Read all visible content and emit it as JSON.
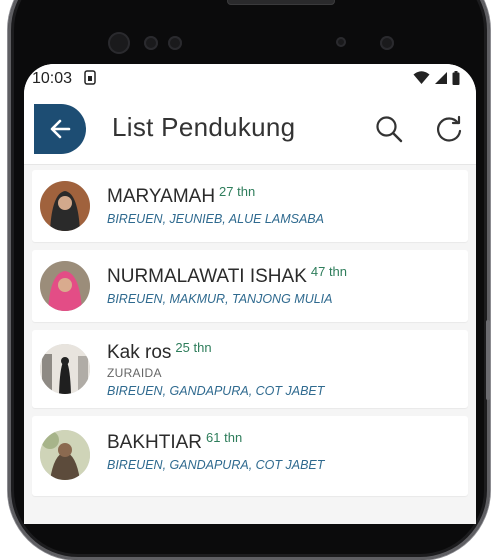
{
  "status_bar": {
    "time": "10:03",
    "sim_icon": "sim-card-icon",
    "icons": [
      "wifi-icon",
      "signal-icon",
      "battery-icon"
    ]
  },
  "app_bar": {
    "title": "List Pendukung",
    "back_icon": "back-arrow-icon",
    "search_icon": "search-icon",
    "refresh_icon": "refresh-icon"
  },
  "colors": {
    "primary": "#1d4d73",
    "age": "#2e7d5b",
    "location": "#2f6a8f"
  },
  "supporters": [
    {
      "name": "MARYAMAH",
      "age": "27 thn",
      "location": "BIREUEN, JEUNIEB, ALUE LAMSABA"
    },
    {
      "name": "NURMALAWATI ISHAK",
      "age": "47 thn",
      "location": "BIREUEN, MAKMUR, TANJONG MULIA"
    },
    {
      "name": "Kak ros",
      "age": "25 thn",
      "subtitle": "ZURAIDA",
      "location": "BIREUEN, GANDAPURA, COT JABET"
    },
    {
      "name": "BAKHTIAR",
      "age": "61 thn",
      "location": "BIREUEN, GANDAPURA, COT JABET"
    }
  ]
}
